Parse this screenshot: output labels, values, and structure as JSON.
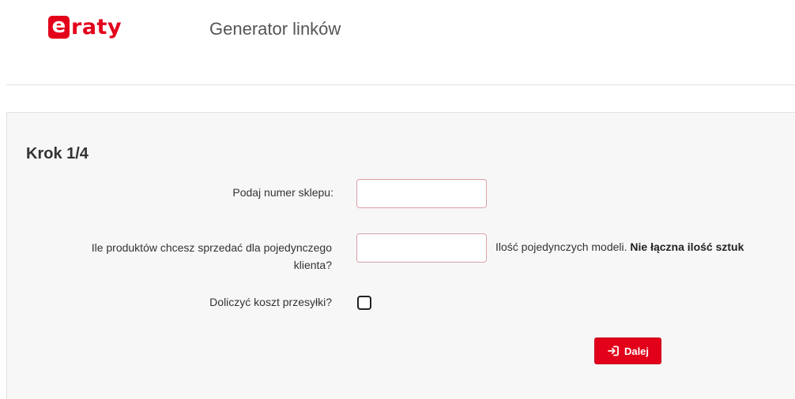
{
  "header": {
    "logo_first_letter": "e",
    "logo_rest": "raty",
    "title": "Generator linków"
  },
  "colors": {
    "brand": "#e3001b",
    "panel_background": "#f7f7f7",
    "text": "#333333"
  },
  "form": {
    "step_title": "Krok 1/4",
    "shop_number": {
      "label": "Podaj numer sklepu:",
      "value": ""
    },
    "products_count": {
      "label_line1": "Ile produktów chcesz sprzedać dla pojedynczego",
      "label_line2": "klienta?",
      "value": "",
      "hint_regular": "Ilość pojedynczych modeli. ",
      "hint_bold": "Nie łączna ilość sztuk"
    },
    "shipping_cost": {
      "label": "Doliczyć koszt przesyłki?",
      "checked": false
    },
    "next_button": {
      "label": "Dalej",
      "icon": "sign-in-icon"
    }
  }
}
